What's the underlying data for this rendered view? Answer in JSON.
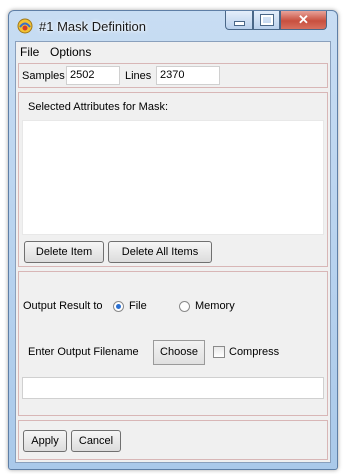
{
  "window": {
    "title": "#1 Mask Definition"
  },
  "menu": {
    "file": "File",
    "options": "Options"
  },
  "dims": {
    "samples_label": "Samples",
    "samples_value": "2502",
    "lines_label": "Lines",
    "lines_value": "2370"
  },
  "attributes": {
    "heading": "Selected Attributes for Mask:",
    "items": [],
    "delete_item": "Delete Item",
    "delete_all": "Delete All Items"
  },
  "output": {
    "label": "Output Result to",
    "options": [
      {
        "label": "File",
        "selected": true
      },
      {
        "label": "Memory",
        "selected": false
      }
    ],
    "filename_label": "Enter Output Filename",
    "choose": "Choose",
    "compress": "Compress",
    "compress_checked": false,
    "filename_value": ""
  },
  "footer": {
    "apply": "Apply",
    "cancel": "Cancel"
  }
}
